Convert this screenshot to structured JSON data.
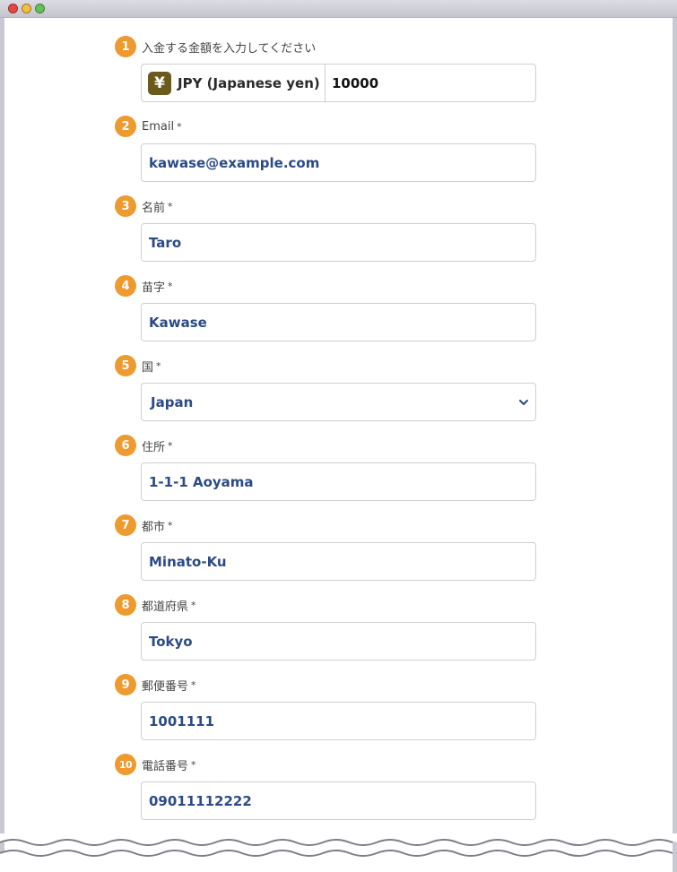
{
  "fields": [
    {
      "num": "1",
      "label": "入金する金額を入力してください",
      "required": "",
      "currency_symbol": "¥",
      "currency": "JPY (Japanese yen)",
      "value": "10000"
    },
    {
      "num": "2",
      "label": "Email",
      "required": "*",
      "value": "kawase@example.com"
    },
    {
      "num": "3",
      "label": "名前",
      "required": "*",
      "value": "Taro"
    },
    {
      "num": "4",
      "label": "苗字",
      "required": "*",
      "value": "Kawase"
    },
    {
      "num": "5",
      "label": "国",
      "required": "*",
      "value": "Japan"
    },
    {
      "num": "6",
      "label": "住所",
      "required": "*",
      "value": "1-1-1 Aoyama"
    },
    {
      "num": "7",
      "label": "都市",
      "required": "*",
      "value": "Minato-Ku"
    },
    {
      "num": "8",
      "label": "都道府県",
      "required": "*",
      "value": "Tokyo"
    },
    {
      "num": "9",
      "label": "郵便番号",
      "required": "*",
      "value": "1001111"
    },
    {
      "num": "10",
      "label": "電話番号",
      "required": "*",
      "value": "09011112222"
    }
  ],
  "colors": {
    "step_badge": "#ee9a2e",
    "input_text": "#2b4a87",
    "currency_badge": "#6b5a1e"
  },
  "icons": {
    "window_controls": [
      "close-dot-icon",
      "minimize-dot-icon",
      "maximize-dot-icon"
    ],
    "country_dropdown": "chevron-down-icon",
    "currency": "yen-icon"
  }
}
